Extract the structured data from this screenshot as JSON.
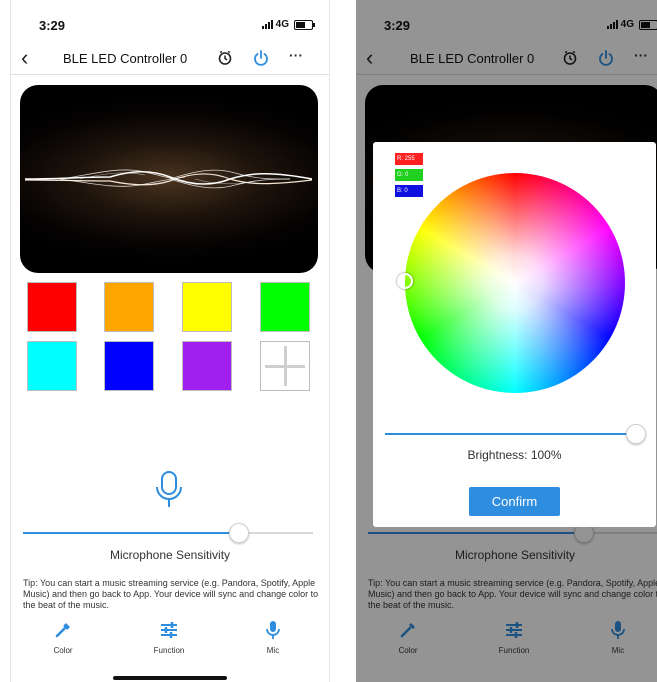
{
  "status": {
    "time": "3:29",
    "network": "4G"
  },
  "nav": {
    "back": "‹",
    "title": "BLE LED Controller 0",
    "more": "···"
  },
  "swatches": [
    "#ff0000",
    "#ffa500",
    "#ffff00",
    "#00ff00",
    "#00ffff",
    "#0000ff",
    "#a020f0"
  ],
  "mic_section": {
    "sensitivity_label": "Microphone Sensitivity",
    "sensitivity_value": 0.74
  },
  "tip": "Tip: You can start a music streaming service (e.g. Pandora, Spotify, Apple Music) and then go back to App. Your device will sync and change color to the beat of the music.",
  "tabs": [
    {
      "label": "Color",
      "icon": "color-picker-icon"
    },
    {
      "label": "Function",
      "icon": "sliders-icon"
    },
    {
      "label": "Mic",
      "icon": "mic-icon"
    }
  ],
  "color_dialog": {
    "r_label": "R: 255",
    "g_label": "G: 0",
    "b_label": "B: 0",
    "brightness_label": "Brightness: 100%",
    "brightness_value": 1.0,
    "confirm_label": "Confirm"
  },
  "colors": {
    "accent": "#2f8ddf",
    "r_badge": "#ff2020",
    "g_badge": "#20d020",
    "b_badge": "#1010e0"
  }
}
